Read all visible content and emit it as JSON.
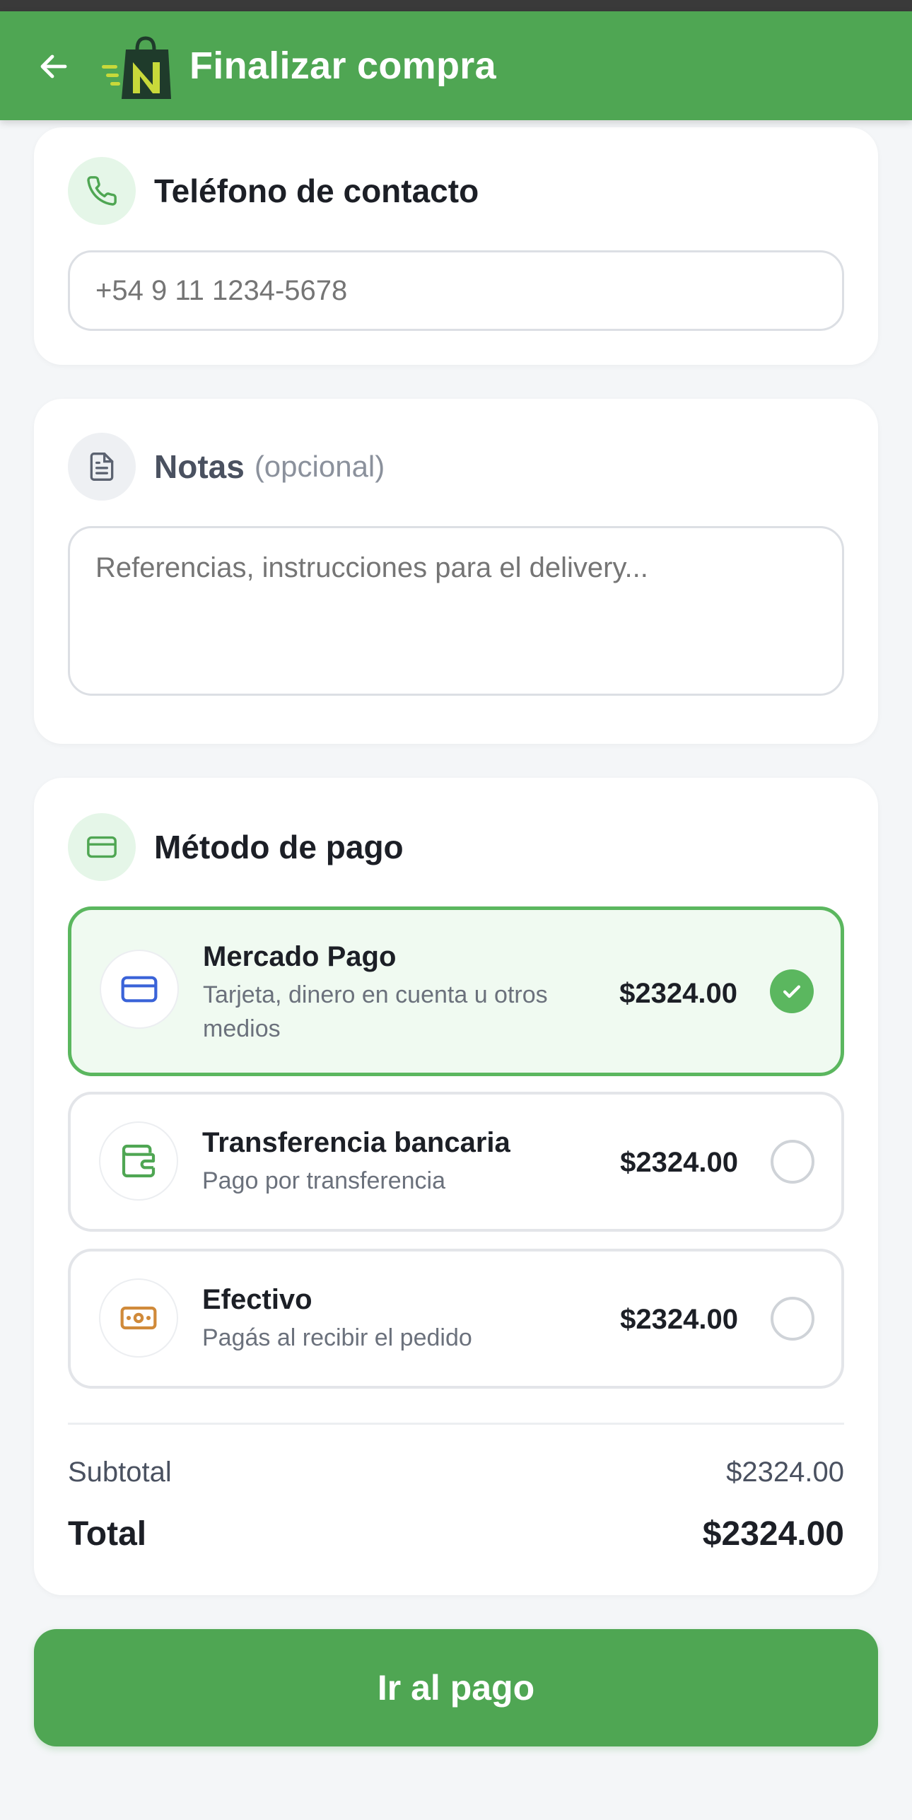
{
  "header": {
    "title": "Finalizar compra",
    "brand_color": "#4fa653"
  },
  "phone": {
    "title": "Teléfono de contacto",
    "placeholder": "+54 9 11 1234-5678"
  },
  "notes": {
    "title": "Notas",
    "subtitle": "(opcional)",
    "placeholder": "Referencias, instrucciones para el delivery..."
  },
  "payment": {
    "title": "Método de pago",
    "options": [
      {
        "title": "Mercado Pago",
        "description": "Tarjeta, dinero en cuenta u otros medios",
        "price": "$2324.00",
        "selected": true,
        "icon": "credit-card-icon"
      },
      {
        "title": "Transferencia bancaria",
        "description": "Pago por transferencia",
        "price": "$2324.00",
        "selected": false,
        "icon": "wallet-icon"
      },
      {
        "title": "Efectivo",
        "description": "Pagás al recibir el pedido",
        "price": "$2324.00",
        "selected": false,
        "icon": "banknote-icon"
      }
    ]
  },
  "summary": {
    "subtotal_label": "Subtotal",
    "subtotal_value": "$2324.00",
    "total_label": "Total",
    "total_value": "$2324.00"
  },
  "actions": {
    "pay_label": "Ir al pago"
  }
}
